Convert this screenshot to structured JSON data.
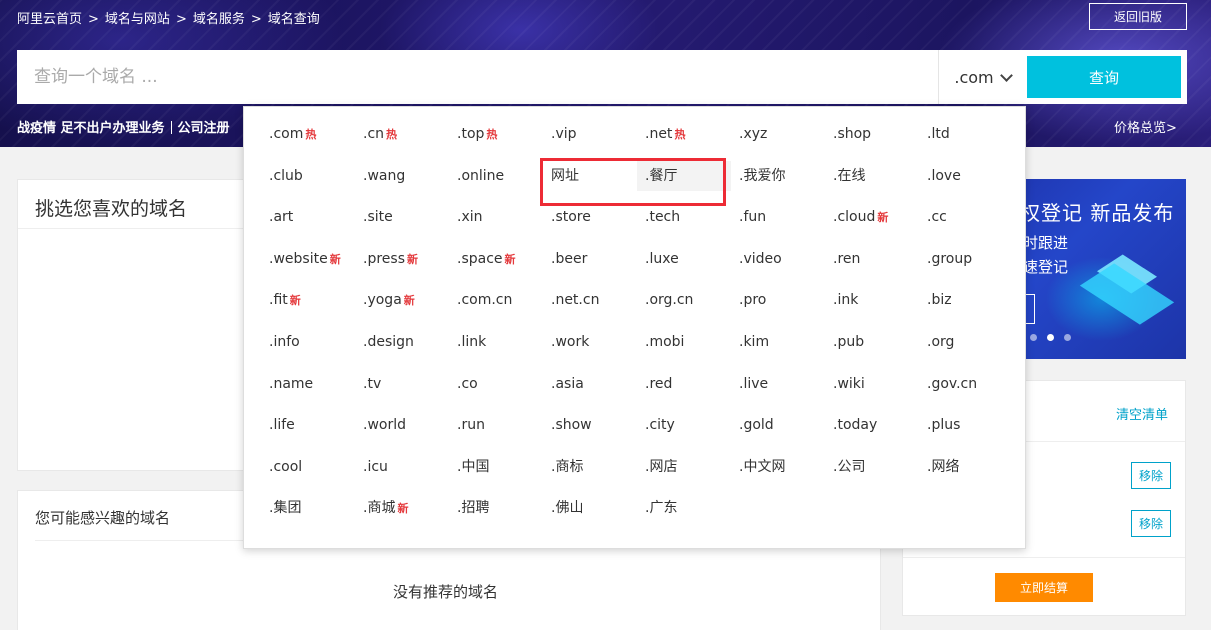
{
  "breadcrumb": [
    "阿里云首页",
    "域名与网站",
    "域名服务",
    "域名查询"
  ],
  "breadcrumb_sep": ">",
  "old_version_label": "返回旧版",
  "search": {
    "placeholder": "查询一个域名 ...",
    "suffix": ".com",
    "button_label": "查询"
  },
  "promo_text_1": "战疫情 足不出户办理业务",
  "promo_text_2": "公司注册",
  "price_link": "价格总览>",
  "pick_panel_title": "挑选您喜欢的域名",
  "interest_panel": {
    "title": "您可能感兴趣的域名",
    "empty_text": "没有推荐的域名"
  },
  "ad": {
    "line1": "权登记 新品发布",
    "line2": "时跟进",
    "line3": "速登记"
  },
  "cart": {
    "clear_label": "清空清单",
    "remove_label": "移除",
    "checkout_label": "立即结算"
  },
  "dropdown": {
    "tlds": [
      {
        "name": ".com",
        "badge": "热"
      },
      {
        "name": ".cn",
        "badge": "热"
      },
      {
        "name": ".top",
        "badge": "热"
      },
      {
        "name": ".vip",
        "badge": ""
      },
      {
        "name": ".net",
        "badge": "热"
      },
      {
        "name": ".xyz",
        "badge": ""
      },
      {
        "name": ".shop",
        "badge": ""
      },
      {
        "name": ".ltd",
        "badge": ""
      },
      {
        "name": ".club",
        "badge": ""
      },
      {
        "name": ".wang",
        "badge": ""
      },
      {
        "name": ".online",
        "badge": ""
      },
      {
        "name": "网址",
        "badge": ""
      },
      {
        "name": ".餐厅",
        "badge": ""
      },
      {
        "name": ".我爱你",
        "badge": ""
      },
      {
        "name": ".在线",
        "badge": ""
      },
      {
        "name": ".love",
        "badge": ""
      },
      {
        "name": ".art",
        "badge": ""
      },
      {
        "name": ".site",
        "badge": ""
      },
      {
        "name": ".xin",
        "badge": ""
      },
      {
        "name": ".store",
        "badge": ""
      },
      {
        "name": ".tech",
        "badge": ""
      },
      {
        "name": ".fun",
        "badge": ""
      },
      {
        "name": ".cloud",
        "badge": "新"
      },
      {
        "name": ".cc",
        "badge": ""
      },
      {
        "name": ".website",
        "badge": "新"
      },
      {
        "name": ".press",
        "badge": "新"
      },
      {
        "name": ".space",
        "badge": "新"
      },
      {
        "name": ".beer",
        "badge": ""
      },
      {
        "name": ".luxe",
        "badge": ""
      },
      {
        "name": ".video",
        "badge": ""
      },
      {
        "name": ".ren",
        "badge": ""
      },
      {
        "name": ".group",
        "badge": ""
      },
      {
        "name": ".fit",
        "badge": "新"
      },
      {
        "name": ".yoga",
        "badge": "新"
      },
      {
        "name": ".com.cn",
        "badge": ""
      },
      {
        "name": ".net.cn",
        "badge": ""
      },
      {
        "name": ".org.cn",
        "badge": ""
      },
      {
        "name": ".pro",
        "badge": ""
      },
      {
        "name": ".ink",
        "badge": ""
      },
      {
        "name": ".biz",
        "badge": ""
      },
      {
        "name": ".info",
        "badge": ""
      },
      {
        "name": ".design",
        "badge": ""
      },
      {
        "name": ".link",
        "badge": ""
      },
      {
        "name": ".work",
        "badge": ""
      },
      {
        "name": ".mobi",
        "badge": ""
      },
      {
        "name": ".kim",
        "badge": ""
      },
      {
        "name": ".pub",
        "badge": ""
      },
      {
        "name": ".org",
        "badge": ""
      },
      {
        "name": ".name",
        "badge": ""
      },
      {
        "name": ".tv",
        "badge": ""
      },
      {
        "name": ".co",
        "badge": ""
      },
      {
        "name": ".asia",
        "badge": ""
      },
      {
        "name": ".red",
        "badge": ""
      },
      {
        "name": ".live",
        "badge": ""
      },
      {
        "name": ".wiki",
        "badge": ""
      },
      {
        "name": ".gov.cn",
        "badge": ""
      },
      {
        "name": ".life",
        "badge": ""
      },
      {
        "name": ".world",
        "badge": ""
      },
      {
        "name": ".run",
        "badge": ""
      },
      {
        "name": ".show",
        "badge": ""
      },
      {
        "name": ".city",
        "badge": ""
      },
      {
        "name": ".gold",
        "badge": ""
      },
      {
        "name": ".today",
        "badge": ""
      },
      {
        "name": ".plus",
        "badge": ""
      },
      {
        "name": ".cool",
        "badge": ""
      },
      {
        "name": ".icu",
        "badge": ""
      },
      {
        "name": ".中国",
        "badge": ""
      },
      {
        "name": ".商标",
        "badge": ""
      },
      {
        "name": ".网店",
        "badge": ""
      },
      {
        "name": ".中文网",
        "badge": ""
      },
      {
        "name": ".公司",
        "badge": ""
      },
      {
        "name": ".网络",
        "badge": ""
      },
      {
        "name": ".集团",
        "badge": ""
      },
      {
        "name": ".商城",
        "badge": "新"
      },
      {
        "name": ".招聘",
        "badge": ""
      },
      {
        "name": ".佛山",
        "badge": ""
      },
      {
        "name": ".广东",
        "badge": ""
      }
    ],
    "highlighted_tld": ".餐厅"
  },
  "colors": {
    "accent": "#00c1de",
    "link": "#00a2ca",
    "badge": "#e4393c",
    "checkout": "#ff8a00",
    "highlight_box": "#ed2b35"
  }
}
